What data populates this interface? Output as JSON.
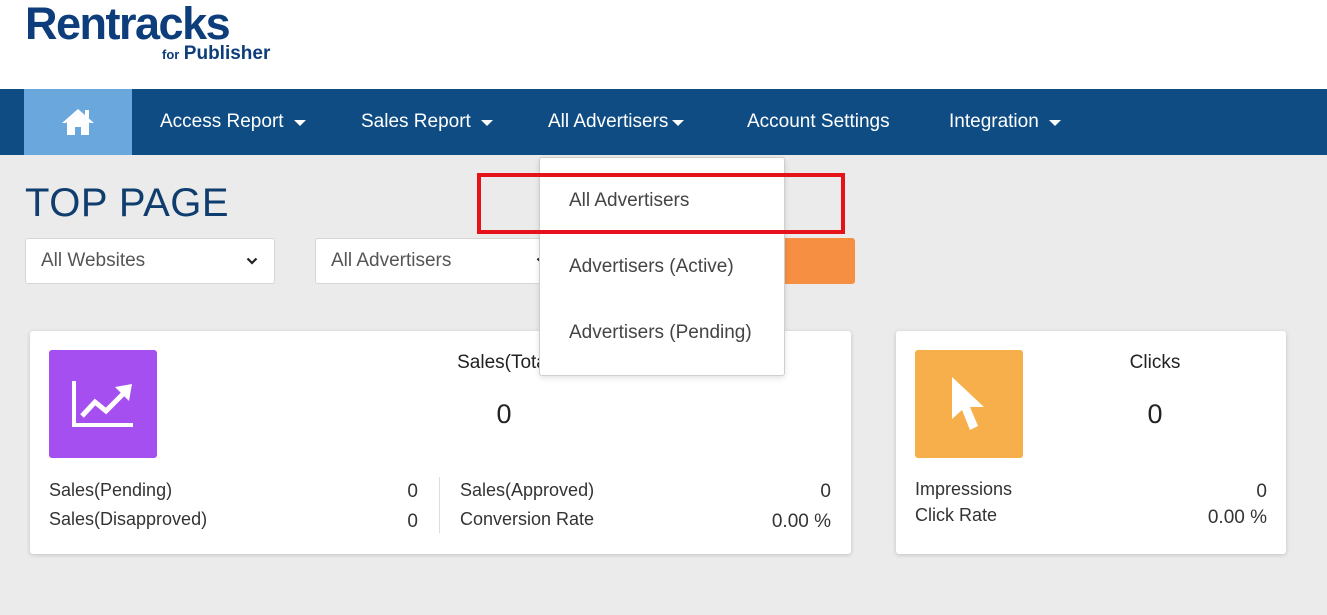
{
  "brand": {
    "name": "Rentracks",
    "sub_for": "for",
    "sub_publisher": "Publisher",
    "primary_color": "#0d3d7a"
  },
  "nav": {
    "home_icon": "home-icon",
    "items": [
      {
        "label": "Access Report",
        "dropdown": true
      },
      {
        "label": "Sales Report",
        "dropdown": true
      },
      {
        "label": "All Advertisers",
        "dropdown": true
      },
      {
        "label": "Account Settings",
        "dropdown": false
      },
      {
        "label": "Integration",
        "dropdown": true
      }
    ],
    "bg_color": "#0f4c84",
    "active_color": "#6aa7dd"
  },
  "page": {
    "title": "TOP PAGE"
  },
  "filters": {
    "websites": "All Websites",
    "advertisers": "All Advertisers",
    "button_color": "#f78f42"
  },
  "dropdown_menu": {
    "items": [
      "All Advertisers",
      "Advertisers (Active)",
      "Advertisers (Pending)"
    ],
    "highlighted": "All Advertisers",
    "highlight_color": "#e6121a"
  },
  "sales_card": {
    "title": "Sales(Tota",
    "value": "0",
    "icon": "trend-chart-icon",
    "icon_color": "#a64ff0",
    "pending_label": "Sales(Pending)",
    "pending_value": "0",
    "disapproved_label": "Sales(Disapproved)",
    "disapproved_value": "0",
    "approved_label": "Sales(Approved)",
    "approved_value": "0",
    "conversion_label": "Conversion Rate",
    "conversion_value": "0.00 %"
  },
  "clicks_card": {
    "title": "Clicks",
    "value": "0",
    "icon": "cursor-pointer-icon",
    "icon_color": "#f7af4b",
    "impressions_label": "Impressions",
    "impressions_value": "0",
    "click_rate_label": "Click Rate",
    "click_rate_value": "0.00 %"
  }
}
